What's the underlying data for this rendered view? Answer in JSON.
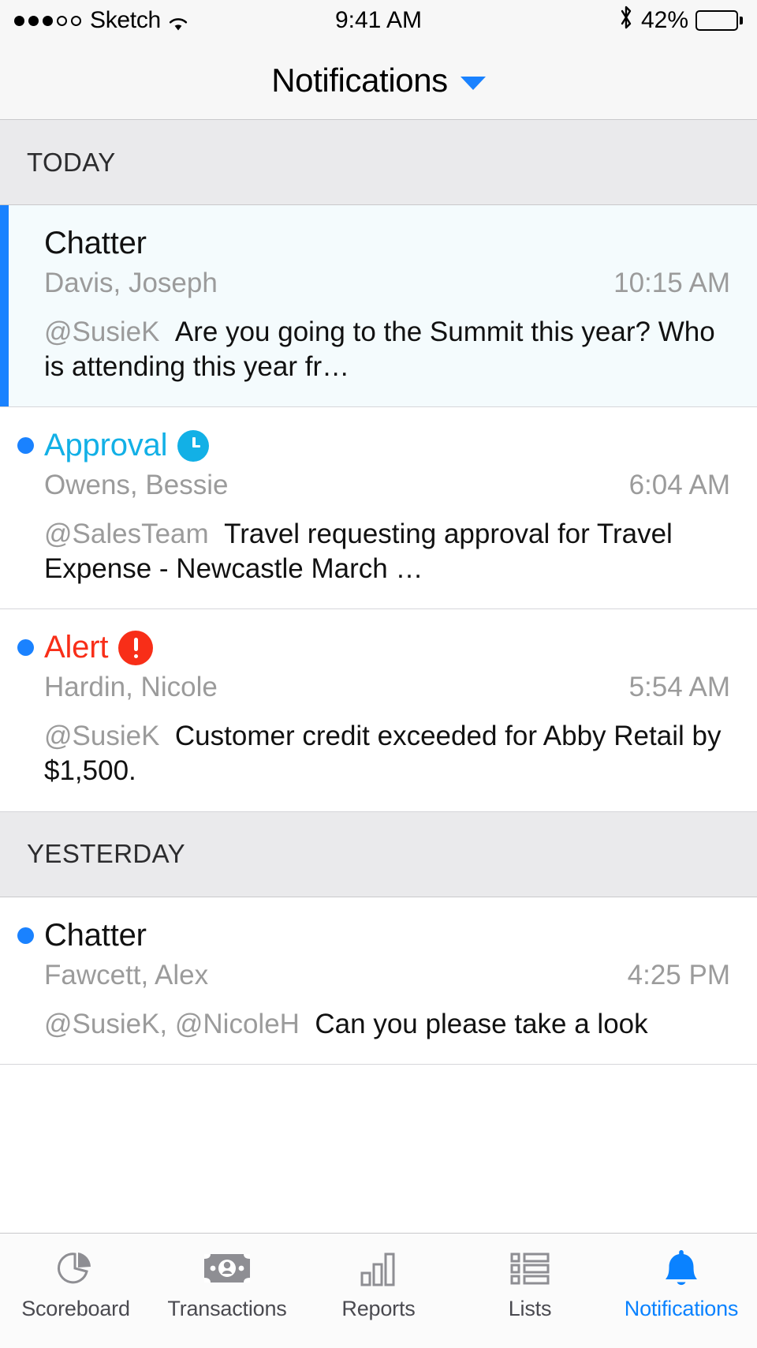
{
  "status_bar": {
    "signal_dots_filled": 3,
    "signal_dots_total": 5,
    "carrier": "Sketch",
    "wifi_icon": "wifi-icon",
    "time": "9:41 AM",
    "bluetooth_icon": "bluetooth-icon",
    "battery_percent": "42%",
    "battery_level": 42,
    "battery_icon": "battery-icon"
  },
  "nav": {
    "title": "Notifications",
    "chevron_icon": "chevron-down-icon"
  },
  "sections": [
    {
      "header": "TODAY",
      "items": [
        {
          "type": "Chatter",
          "type_style": "default",
          "accent_bar": true,
          "unread_bullet": false,
          "badge": "none",
          "sender": "Davis, Joseph",
          "time": "10:15 AM",
          "mention": "@SusieK",
          "message": "Are you going to the Summit this year? Who is attending this year fr…"
        },
        {
          "type": "Approval",
          "type_style": "approval",
          "accent_bar": false,
          "unread_bullet": true,
          "badge": "clock",
          "sender": "Owens, Bessie",
          "time": "6:04 AM",
          "mention": "@SalesTeam",
          "message": "Travel requesting approval for Travel Expense - Newcastle March …"
        },
        {
          "type": "Alert",
          "type_style": "alert",
          "accent_bar": false,
          "unread_bullet": true,
          "badge": "alert",
          "sender": "Hardin, Nicole",
          "time": "5:54 AM",
          "mention": "@SusieK",
          "message": "Customer credit exceeded for Abby Retail by $1,500."
        }
      ]
    },
    {
      "header": "YESTERDAY",
      "items": [
        {
          "type": "Chatter",
          "type_style": "default",
          "accent_bar": false,
          "unread_bullet": true,
          "badge": "none",
          "sender": "Fawcett, Alex",
          "time": "4:25 PM",
          "mention": "@SusieK, @NicoleH",
          "message": "Can you please take a look"
        }
      ]
    }
  ],
  "tabs": [
    {
      "label": "Scoreboard",
      "icon": "pie-chart-icon",
      "active": false
    },
    {
      "label": "Transactions",
      "icon": "banknote-icon",
      "active": false
    },
    {
      "label": "Reports",
      "icon": "bar-chart-icon",
      "active": false
    },
    {
      "label": "Lists",
      "icon": "bullet-list-icon",
      "active": false
    },
    {
      "label": "Notifications",
      "icon": "bell-icon",
      "active": true
    }
  ],
  "colors": {
    "accent_blue": "#1a82ff",
    "tab_active_blue": "#0a82ff",
    "approval_cyan": "#12b0e6",
    "alert_red": "#f82e18",
    "section_gray": "#eaeaec",
    "unread_row_bg": "#f4fbfd",
    "muted_text": "#9b9b9b"
  }
}
